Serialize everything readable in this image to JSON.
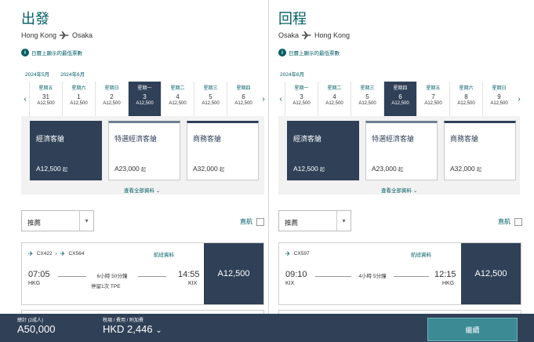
{
  "outbound": {
    "title": "出發",
    "from": "Hong Kong",
    "to": "Osaka",
    "info": "日曆上顯示的最低票數",
    "months": [
      "2024年5月",
      "2024年6月"
    ],
    "days": [
      {
        "dow": "星期五",
        "day": "31",
        "price": "A12,500"
      },
      {
        "dow": "星期六",
        "day": "1",
        "price": "A12,500"
      },
      {
        "dow": "星期日",
        "day": "2",
        "price": "A12,500"
      },
      {
        "dow": "星期一",
        "day": "3",
        "price": "A12,500"
      },
      {
        "dow": "星期二",
        "day": "4",
        "price": "A12,500"
      },
      {
        "dow": "星期三",
        "day": "5",
        "price": "A12,500"
      },
      {
        "dow": "星期四",
        "day": "6",
        "price": "A12,500"
      }
    ],
    "cabins": [
      {
        "name": "經濟客艙",
        "price": "A12,500",
        "suffix": "起"
      },
      {
        "name": "特選經濟客艙",
        "price": "A23,000",
        "suffix": "起"
      },
      {
        "name": "商務客艙",
        "price": "A32,000",
        "suffix": "起"
      }
    ],
    "more": "查看全部資料",
    "sort": "推薦",
    "direct": "直航",
    "flight": {
      "codes": [
        "CX422",
        "CX564"
      ],
      "details": "航班資料",
      "dep_time": "07:05",
      "dep_port": "HKG",
      "duration": "6小時 50分鐘",
      "stops": "停留1次 TPE",
      "arr_time": "14:55",
      "arr_port": "KIX",
      "price": "A12,500"
    }
  },
  "return": {
    "title": "回程",
    "from": "Osaka",
    "to": "Hong Kong",
    "info": "日曆上顯示的最低票數",
    "months": [
      "2024年6月"
    ],
    "days": [
      {
        "dow": "星期一",
        "day": "3",
        "price": "A12,500"
      },
      {
        "dow": "星期二",
        "day": "4",
        "price": "A12,500"
      },
      {
        "dow": "星期三",
        "day": "5",
        "price": "A12,500"
      },
      {
        "dow": "星期四",
        "day": "6",
        "price": "A12,500"
      },
      {
        "dow": "星期五",
        "day": "7",
        "price": "A12,500"
      },
      {
        "dow": "星期六",
        "day": "8",
        "price": "A12,500"
      },
      {
        "dow": "星期日",
        "day": "9",
        "price": "A12,500"
      }
    ],
    "cabins": [
      {
        "name": "經濟客艙",
        "price": "A12,500",
        "suffix": "起"
      },
      {
        "name": "特選經濟客艙",
        "price": "A23,000",
        "suffix": "起"
      },
      {
        "name": "商務客艙",
        "price": "A32,000",
        "suffix": "起"
      }
    ],
    "more": "查看全部資料",
    "sort": "推薦",
    "direct": "直航",
    "flight": {
      "codes": [
        "CX597"
      ],
      "details": "航班資料",
      "dep_time": "09:10",
      "dep_port": "KIX",
      "duration": "4小時 5分鐘",
      "arr_time": "12:15",
      "arr_port": "HKG",
      "price": "A12,500"
    }
  },
  "footer": {
    "total_label": "總計 (2成人)",
    "total_value": "A50,000",
    "tax_label": "稅項 / 費用 / 附加費",
    "tax_value": "HKD 2,446",
    "continue": "繼續"
  },
  "colors": {
    "brand": "#005d63",
    "navy": "#2f4057",
    "accent": "#3b8a94"
  }
}
